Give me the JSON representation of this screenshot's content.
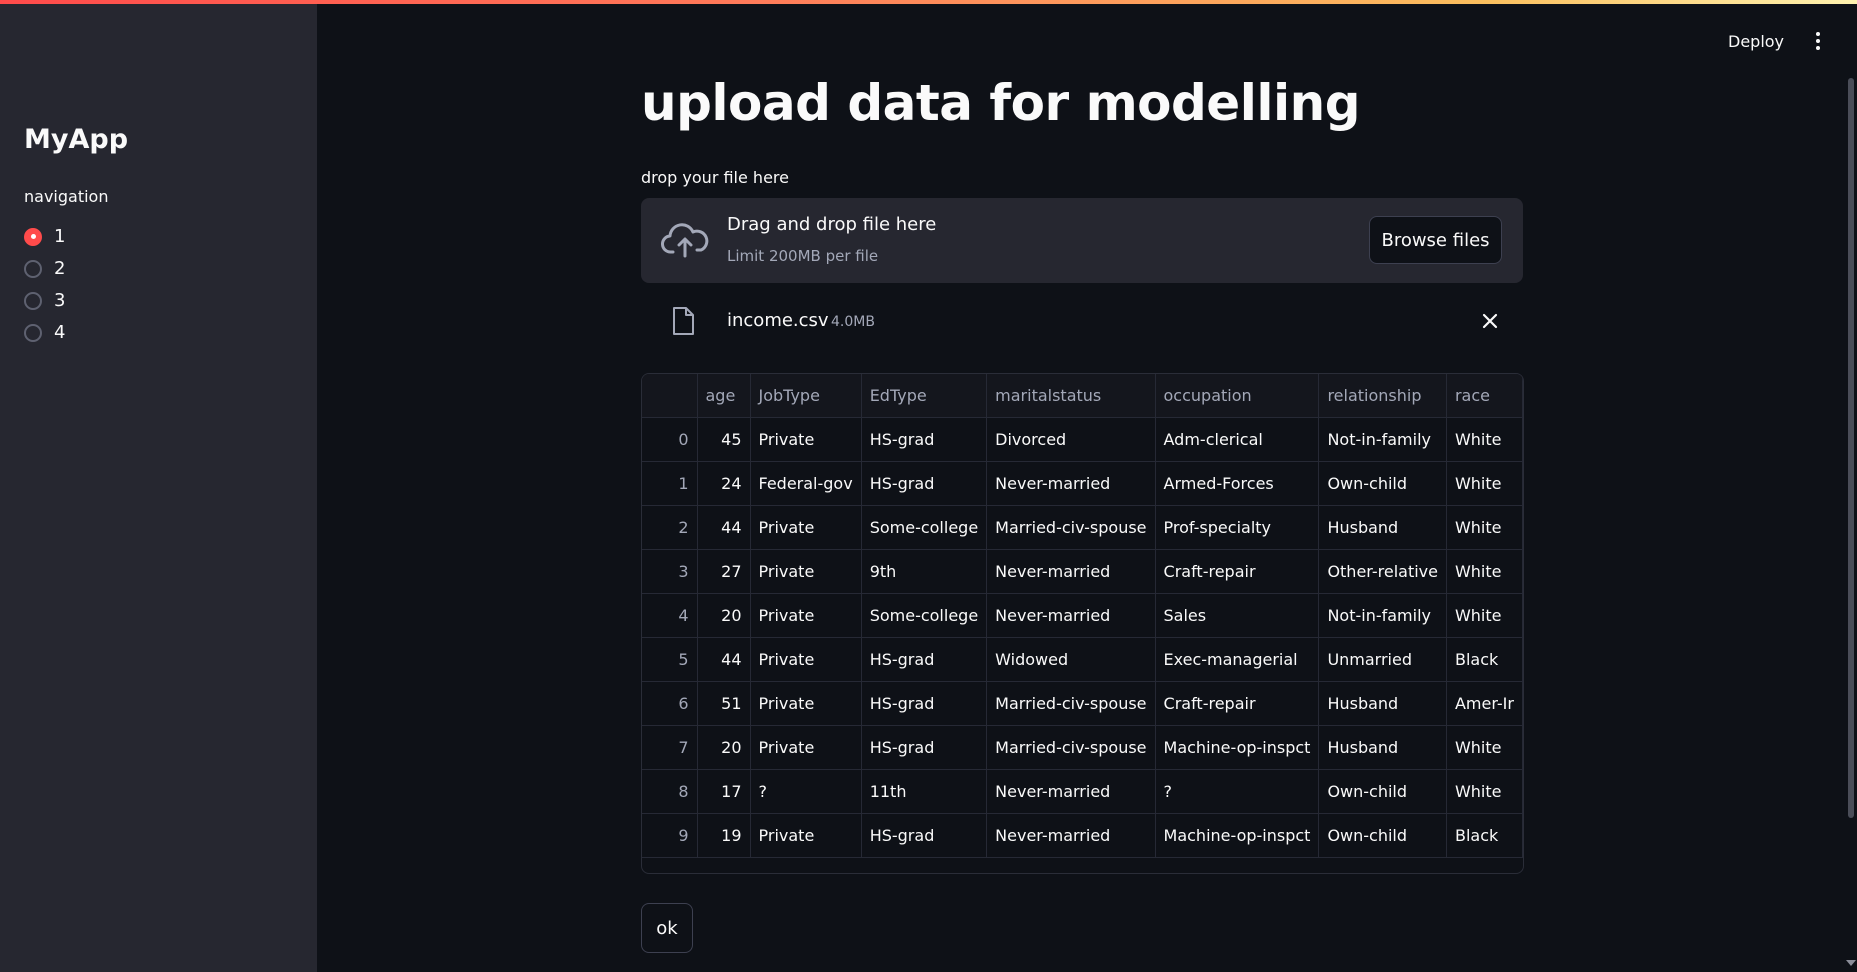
{
  "app": {
    "sidebar_title": "MyApp",
    "nav_label": "navigation",
    "nav_options": [
      "1",
      "2",
      "3",
      "4"
    ],
    "nav_selected": "1"
  },
  "header": {
    "deploy_label": "Deploy",
    "menu_icon": "kebab-menu-icon"
  },
  "main": {
    "title": "upload data for modelling",
    "uploader": {
      "label": "drop your file here",
      "drop_text": "Drag and drop file here",
      "limit_text": "Limit 200MB per file",
      "browse_label": "Browse files",
      "icon": "cloud-upload-icon"
    },
    "uploaded_file": {
      "name": "income.csv",
      "size": "4.0MB",
      "icon": "file-icon",
      "remove_icon": "close-icon"
    },
    "table": {
      "columns": [
        "",
        "age",
        "JobType",
        "EdType",
        "maritalstatus",
        "occupation",
        "relationship",
        "race"
      ],
      "rows": [
        [
          "0",
          "45",
          "Private",
          "HS-grad",
          "Divorced",
          "Adm-clerical",
          "Not-in-family",
          "White"
        ],
        [
          "1",
          "24",
          "Federal-gov",
          "HS-grad",
          "Never-married",
          "Armed-Forces",
          "Own-child",
          "White"
        ],
        [
          "2",
          "44",
          "Private",
          "Some-college",
          "Married-civ-spouse",
          "Prof-specialty",
          "Husband",
          "White"
        ],
        [
          "3",
          "27",
          "Private",
          "9th",
          "Never-married",
          "Craft-repair",
          "Other-relative",
          "White"
        ],
        [
          "4",
          "20",
          "Private",
          "Some-college",
          "Never-married",
          "Sales",
          "Not-in-family",
          "White"
        ],
        [
          "5",
          "44",
          "Private",
          "HS-grad",
          "Widowed",
          "Exec-managerial",
          "Unmarried",
          "Black"
        ],
        [
          "6",
          "51",
          "Private",
          "HS-grad",
          "Married-civ-spouse",
          "Craft-repair",
          "Husband",
          "Amer-Ir"
        ],
        [
          "7",
          "20",
          "Private",
          "HS-grad",
          "Married-civ-spouse",
          "Machine-op-inspct",
          "Husband",
          "White"
        ],
        [
          "8",
          "17",
          "?",
          "11th",
          "Never-married",
          "?",
          "Own-child",
          "White"
        ],
        [
          "9",
          "19",
          "Private",
          "HS-grad",
          "Never-married",
          "Machine-op-inspct",
          "Own-child",
          "Black"
        ]
      ]
    },
    "ok_label": "ok"
  },
  "colors": {
    "accent": "#ff4b4b",
    "background": "#0e1117",
    "sidebar_bg": "#262730",
    "text": "#fafafa",
    "muted_text": "#a3a8b8"
  }
}
